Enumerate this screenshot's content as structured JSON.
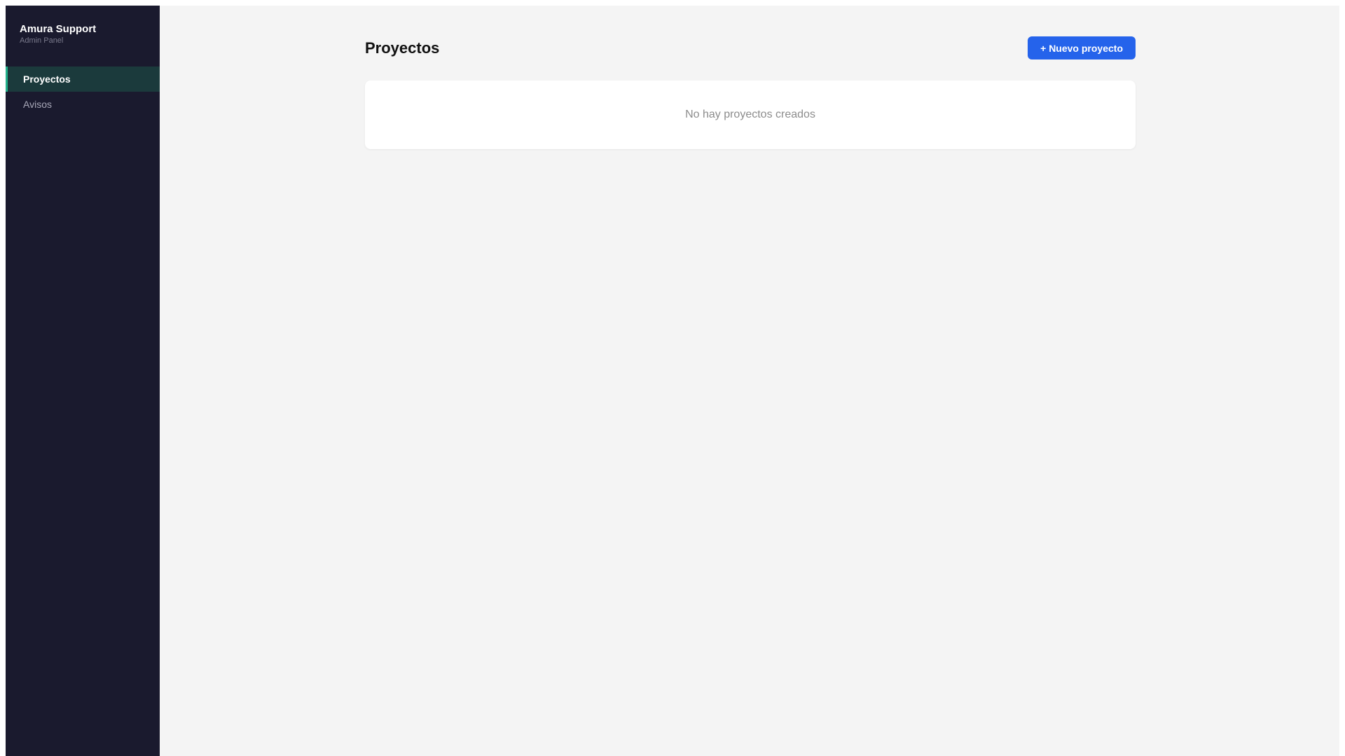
{
  "sidebar": {
    "brand_title": "Amura Support",
    "brand_subtitle": "Admin Panel",
    "items": [
      {
        "label": "Proyectos",
        "active": true
      },
      {
        "label": "Avisos",
        "active": false
      }
    ]
  },
  "main": {
    "page_title": "Proyectos",
    "new_button_label": "+ Nuevo proyecto",
    "empty_message": "No hay proyectos creados"
  },
  "colors": {
    "sidebar_bg": "#1a1a2e",
    "active_item_bg": "#1b3a3c",
    "active_accent": "#22b08a",
    "primary_button": "#2563eb",
    "page_bg": "#f4f4f4"
  }
}
